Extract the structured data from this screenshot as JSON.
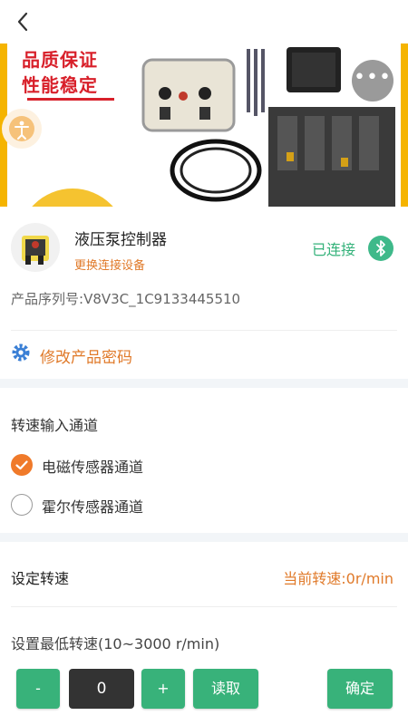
{
  "banner": {
    "slogan1": "品质保证",
    "slogan2": "性能稳定",
    "more_label": "•••"
  },
  "device": {
    "name": "液压泵控制器",
    "change_label": "更换连接设备",
    "status": "已连接",
    "serial_label": "产品序列号:",
    "serial_value": "V8V3C_1C9133445510",
    "password_label": "修改产品密码"
  },
  "channel": {
    "title": "转速输入通道",
    "options": [
      {
        "label": "电磁传感器通道",
        "checked": true
      },
      {
        "label": "霍尔传感器通道",
        "checked": false
      }
    ]
  },
  "speed": {
    "title": "设定转速",
    "current": "当前转速:0r/min",
    "range_label": "设置最低转速(10~3000 r/min)",
    "minus_label": "-",
    "value": "0",
    "plus_label": "+",
    "read_label": "读取",
    "confirm_label": "确定"
  },
  "colors": {
    "accent_green": "#38b27a",
    "accent_orange": "#e07a2a",
    "slogan_red": "#d8202a"
  }
}
